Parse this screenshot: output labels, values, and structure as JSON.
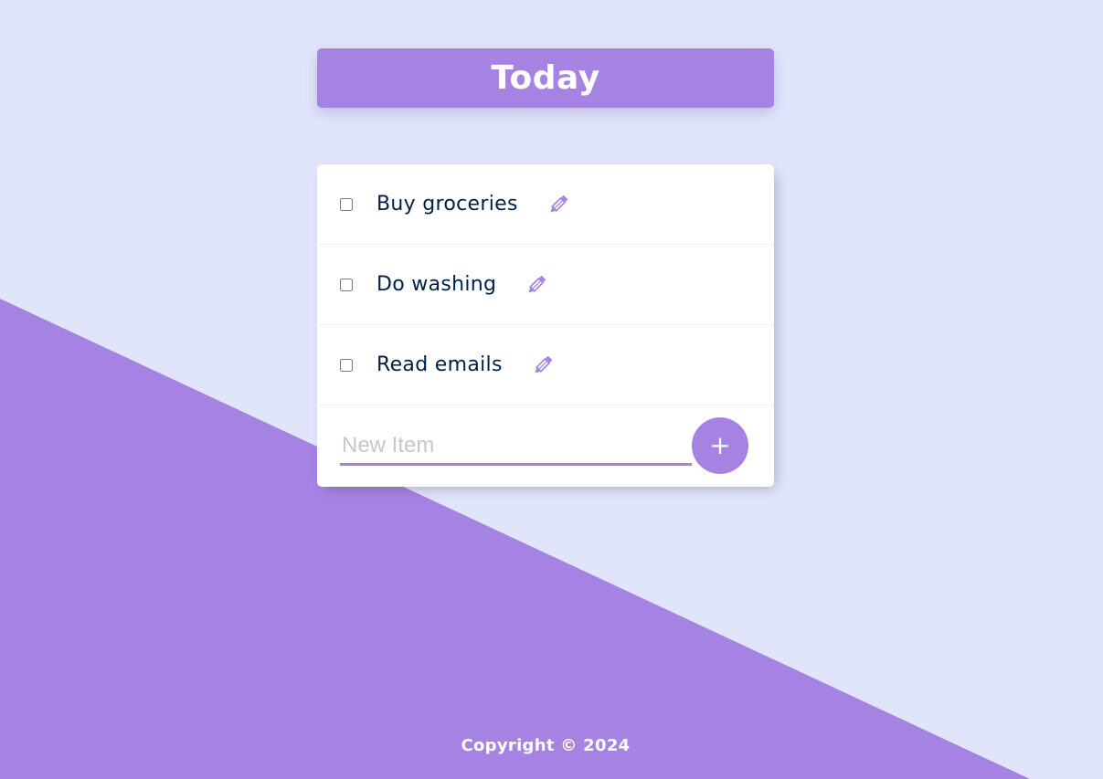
{
  "header": {
    "title": "Today"
  },
  "items": [
    {
      "label": "Buy groceries",
      "checked": false
    },
    {
      "label": "Do washing",
      "checked": false
    },
    {
      "label": "Read emails",
      "checked": false
    }
  ],
  "new_item": {
    "placeholder": "New Item",
    "value": "",
    "add_label": "+"
  },
  "footer": {
    "copyright": "Copyright © 2024"
  },
  "colors": {
    "background": "#E1E5FB",
    "accent": "#A683E3",
    "text": "#00204A",
    "card": "#FFFFFF"
  },
  "icons": {
    "edit": "pencil-icon"
  }
}
